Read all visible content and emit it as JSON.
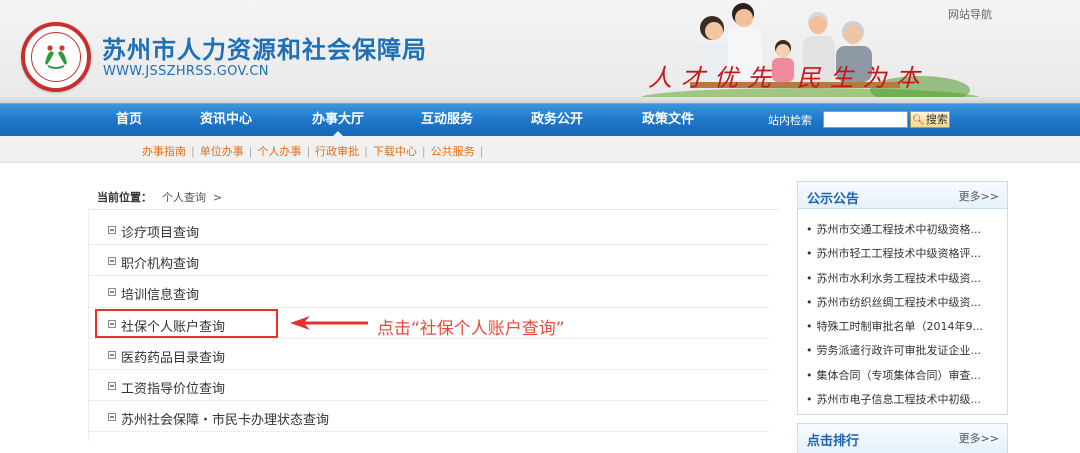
{
  "header": {
    "title": "苏州市人力资源和社会保障局",
    "url": "WWW.JSSZHRSS.GOV.CN",
    "site_nav": "网站导航",
    "slogan": "人才优先 民生为本"
  },
  "main_nav": {
    "items": [
      "首页",
      "资讯中心",
      "办事大厅",
      "互动服务",
      "政务公开",
      "政策文件"
    ],
    "active": "办事大厅",
    "search_label": "站内检索",
    "search_value": "",
    "search_button": "搜索"
  },
  "sub_nav": {
    "items": [
      "办事指南",
      "单位办事",
      "个人办事",
      "行政审批",
      "下载中心",
      "公共服务"
    ],
    "separator": "|"
  },
  "breadcrumb": {
    "label": "当前位置：",
    "current": "个人查询",
    "arrow": ">"
  },
  "query_list": [
    "诊疗项目查询",
    "职介机构查询",
    "培训信息查询",
    "社保个人账户查询",
    "医药药品目录查询",
    "工资指导价位查询",
    "苏州社会保障・市民卡办理状态查询"
  ],
  "annotation": {
    "highlighted_item": "社保个人账户查询",
    "callout": "点击“社保个人账户查询”",
    "color": "#e5322d"
  },
  "notice_panel": {
    "title": "公示公告",
    "more": "更多>>",
    "items": [
      "苏州市交通工程技术中初级资格...",
      "苏州市轻工工程技术中级资格评...",
      "苏州市水利水务工程技术中级资...",
      "苏州市纺织丝绸工程技术中级资...",
      "特殊工时制审批名单（2014年9...",
      "劳务派遣行政许可审批发证企业...",
      "集体合同（专项集体合同）审查...",
      "苏州市电子信息工程技术中初级..."
    ]
  },
  "ranking_panel": {
    "title": "点击排行",
    "more": "更多>>"
  },
  "colors": {
    "brand_blue": "#1f6fb4",
    "nav_blue": "#1f77c8",
    "subnav_orange": "#e2701c",
    "slogan_red": "#c8161d"
  }
}
